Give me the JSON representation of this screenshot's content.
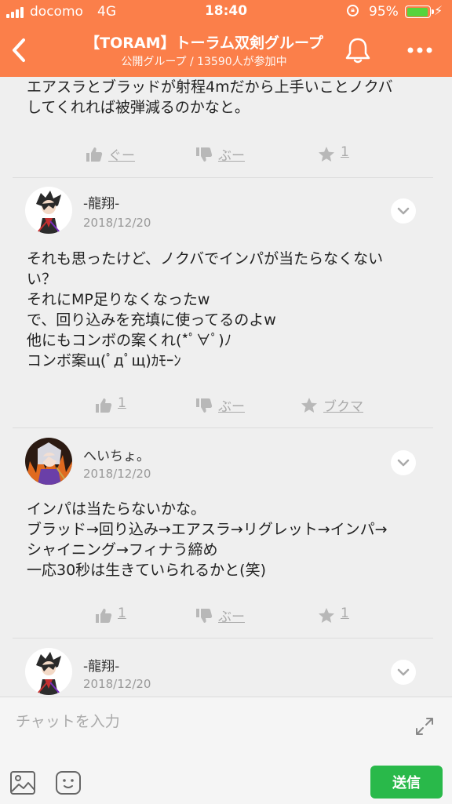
{
  "status_bar": {
    "carrier": "docomo",
    "network": "4G",
    "time": "18:40",
    "battery_percent": "95%",
    "battery_level": 0.95,
    "battery_color": "#57d43c"
  },
  "header": {
    "title": "【TORAM】トーラム双剣グループ",
    "subtitle": "公開グループ / 13590人が参加中",
    "background_color": "#fb7f4a"
  },
  "posts": [
    {
      "text": [
        "エアスラとブラッドが射程4mだから上手いことノクバ",
        "してくれれば被弾減るのかなと。"
      ],
      "actions": {
        "like": "ぐー",
        "dislike": "ぶー",
        "star": "1"
      }
    },
    {
      "author": "-龍翔-",
      "date": "2018/12/20",
      "text": [
        "それも思ったけど、ノクバでインパが当たらなくない",
        "い？",
        "それにMP足りなくなったw",
        "で、回り込みを充填に使ってるのよw",
        "他にもコンボの案くれ(*ﾟ∀ﾟ)ﾉ",
        "コンボ案щ(ﾟдﾟщ)ｶﾓｰﾝ"
      ],
      "actions": {
        "like": "1",
        "dislike": "ぶー",
        "star": "ブクマ"
      }
    },
    {
      "author": "へいちょ。",
      "date": "2018/12/20",
      "text": [
        "インパは当たらないかな。",
        "ブラッド→回り込み→エアスラ→リグレット→インパ→",
        "シャイニング→フィナう締め",
        "一応30秒は生きていられるかと(笑)"
      ],
      "actions": {
        "like": "1",
        "dislike": "ぶー",
        "star": "1"
      }
    },
    {
      "author": "-龍翔-",
      "date": "2018/12/20"
    }
  ],
  "input_bar": {
    "placeholder": "チャットを入力",
    "send_label": "送信",
    "send_color": "#29b94a"
  }
}
